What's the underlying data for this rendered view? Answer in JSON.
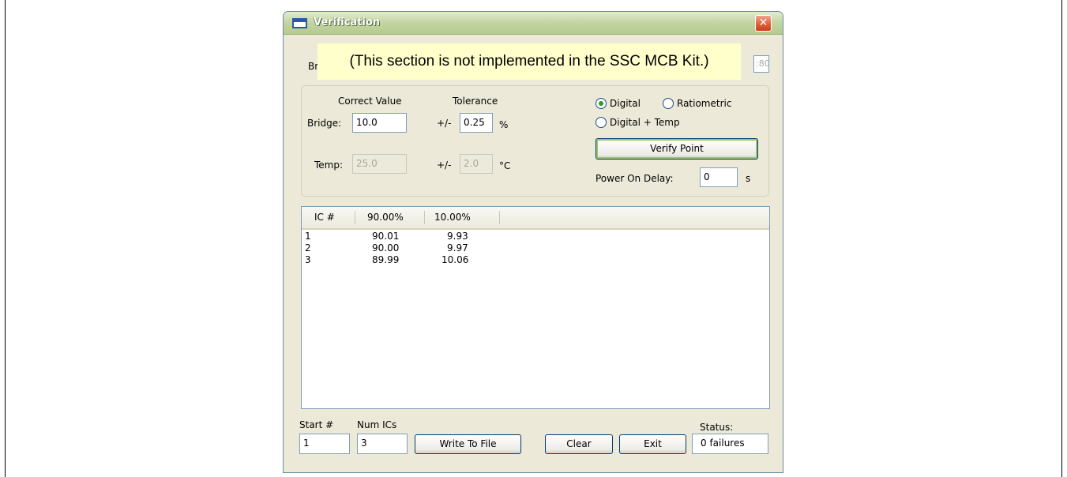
{
  "window": {
    "title": "Verification",
    "close_glyph": "✕"
  },
  "bridge_row": {
    "label_partial": "Bri",
    "input_partial": ":80"
  },
  "callout": "(This section is not implemented in the SSC MCB Kit.)",
  "measure": {
    "col_correct_value": "Correct Value",
    "col_tolerance": "Tolerance",
    "bridge_label": "Bridge:",
    "bridge_value": "10.0",
    "bridge_pm": "+/-",
    "bridge_tol": "0.25",
    "bridge_unit": "%",
    "temp_label": "Temp:",
    "temp_value": "25.0",
    "temp_pm": "+/-",
    "temp_tol": "2.0",
    "temp_unit": "°C"
  },
  "mode": {
    "digital": "Digital",
    "ratiometric": "Ratiometric",
    "digital_temp": "Digital + Temp",
    "selected": "digital"
  },
  "verify_button": "Verify Point",
  "power_on": {
    "label": "Power On Delay:",
    "value": "0",
    "unit": "s"
  },
  "table": {
    "headers": [
      "IC #",
      "90.00%",
      "10.00%"
    ],
    "rows": [
      [
        "1",
        "90.01",
        "9.93"
      ],
      [
        "2",
        "90.00",
        "9.97"
      ],
      [
        "3",
        "89.99",
        "10.06"
      ]
    ]
  },
  "bottom": {
    "start_label": "Start #",
    "start_value": "1",
    "num_label": "Num ICs",
    "num_value": "3",
    "write_button": "Write To File",
    "clear_button": "Clear",
    "exit_button": "Exit",
    "status_label": "Status:",
    "status_value": "0 failures"
  }
}
